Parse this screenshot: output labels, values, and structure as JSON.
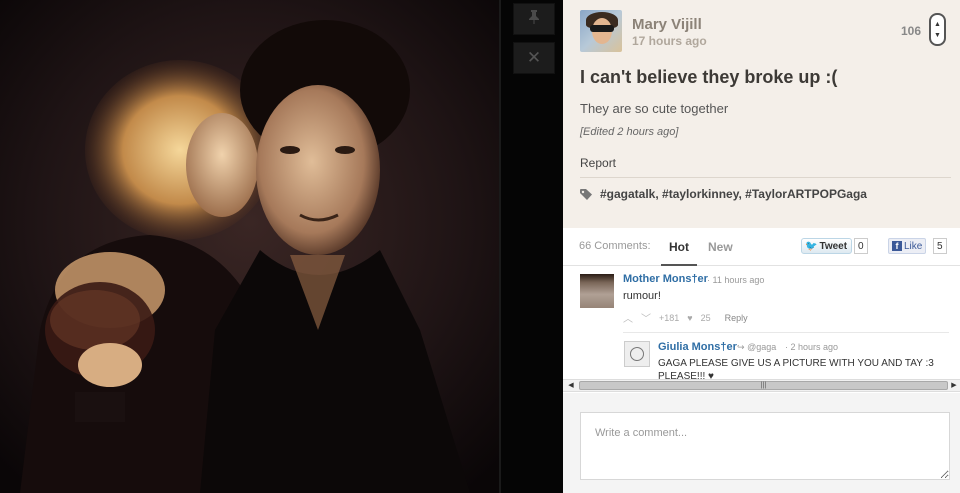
{
  "post": {
    "author": "Mary Vijill",
    "time": "17 hours ago",
    "score": "106",
    "title": "I can't believe they broke up :(",
    "body": "They are so cute together",
    "edited": "[Edited 2 hours ago]",
    "report_label": "Report",
    "tags": "#gagatalk, #taylorkinney, #TaylorARTPOPGaga"
  },
  "controls": {
    "pin_icon": "pin-icon",
    "close_icon": "close-icon"
  },
  "comments": {
    "count_label": "66 Comments:",
    "tab_hot": "Hot",
    "tab_new": "New",
    "tweet_label": "Tweet",
    "tweet_count": "0",
    "like_label": "Like",
    "like_count": "5",
    "items": [
      {
        "author": "Mother Mons†er",
        "time": "11 hours ago",
        "text": "rumour!",
        "score": "+181",
        "hearts": "25",
        "reply_label": "Reply"
      },
      {
        "author": "Giulia Mons†er",
        "reply_to": "@gaga",
        "time": "2 hours ago",
        "text": "GAGA PLEASE GIVE US A PICTURE WITH YOU AND TAY :3 PLEASE!!! ♥"
      }
    ],
    "input_placeholder": "Write a comment..."
  },
  "colors": {
    "panel_bg": "#f4efe9",
    "link_blue": "#2f6ea5",
    "dark_bg": "#050505"
  }
}
